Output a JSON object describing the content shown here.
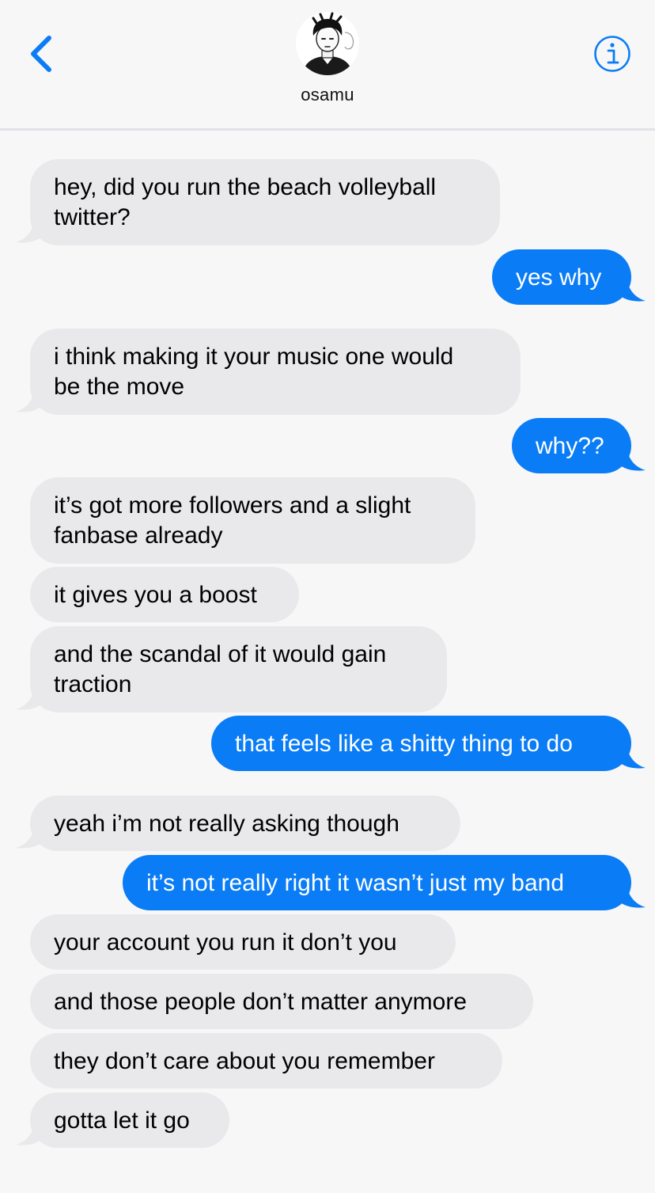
{
  "header": {
    "contact_name": "osamu",
    "back_icon": "chevron-left-icon",
    "info_icon": "info-circle-icon",
    "avatar_icon": "contact-avatar-sketch"
  },
  "colors": {
    "incoming_bubble": "#e9e9eb",
    "outgoing_bubble": "#0a7cf6",
    "accent": "#0a7cf6",
    "background": "#f7f7f8"
  },
  "messages": [
    {
      "direction": "incoming",
      "lines": [
        "hey, did you run the beach volleyball",
        "twitter?"
      ]
    },
    {
      "direction": "outgoing",
      "lines": [
        "yes why"
      ]
    },
    {
      "direction": "incoming",
      "lines": [
        "i think making it your music one would",
        "be the move"
      ]
    },
    {
      "direction": "outgoing",
      "lines": [
        "why??"
      ]
    },
    {
      "direction": "incoming",
      "lines": [
        "it’s got more followers and a slight",
        "fanbase already"
      ]
    },
    {
      "direction": "incoming",
      "lines": [
        "it gives you a boost"
      ]
    },
    {
      "direction": "incoming",
      "lines": [
        "and the scandal of it would gain",
        "traction"
      ]
    },
    {
      "direction": "outgoing",
      "lines": [
        "that feels like a shitty thing to do"
      ]
    },
    {
      "direction": "incoming",
      "lines": [
        "yeah i’m not really asking though"
      ]
    },
    {
      "direction": "outgoing",
      "lines": [
        "it’s not really right it wasn’t just my band"
      ]
    },
    {
      "direction": "incoming",
      "lines": [
        "your account you run it don’t you"
      ]
    },
    {
      "direction": "incoming",
      "lines": [
        "and those people don’t matter anymore"
      ]
    },
    {
      "direction": "incoming",
      "lines": [
        "they don’t care about you remember"
      ]
    },
    {
      "direction": "incoming",
      "lines": [
        "gotta let it go"
      ]
    }
  ]
}
